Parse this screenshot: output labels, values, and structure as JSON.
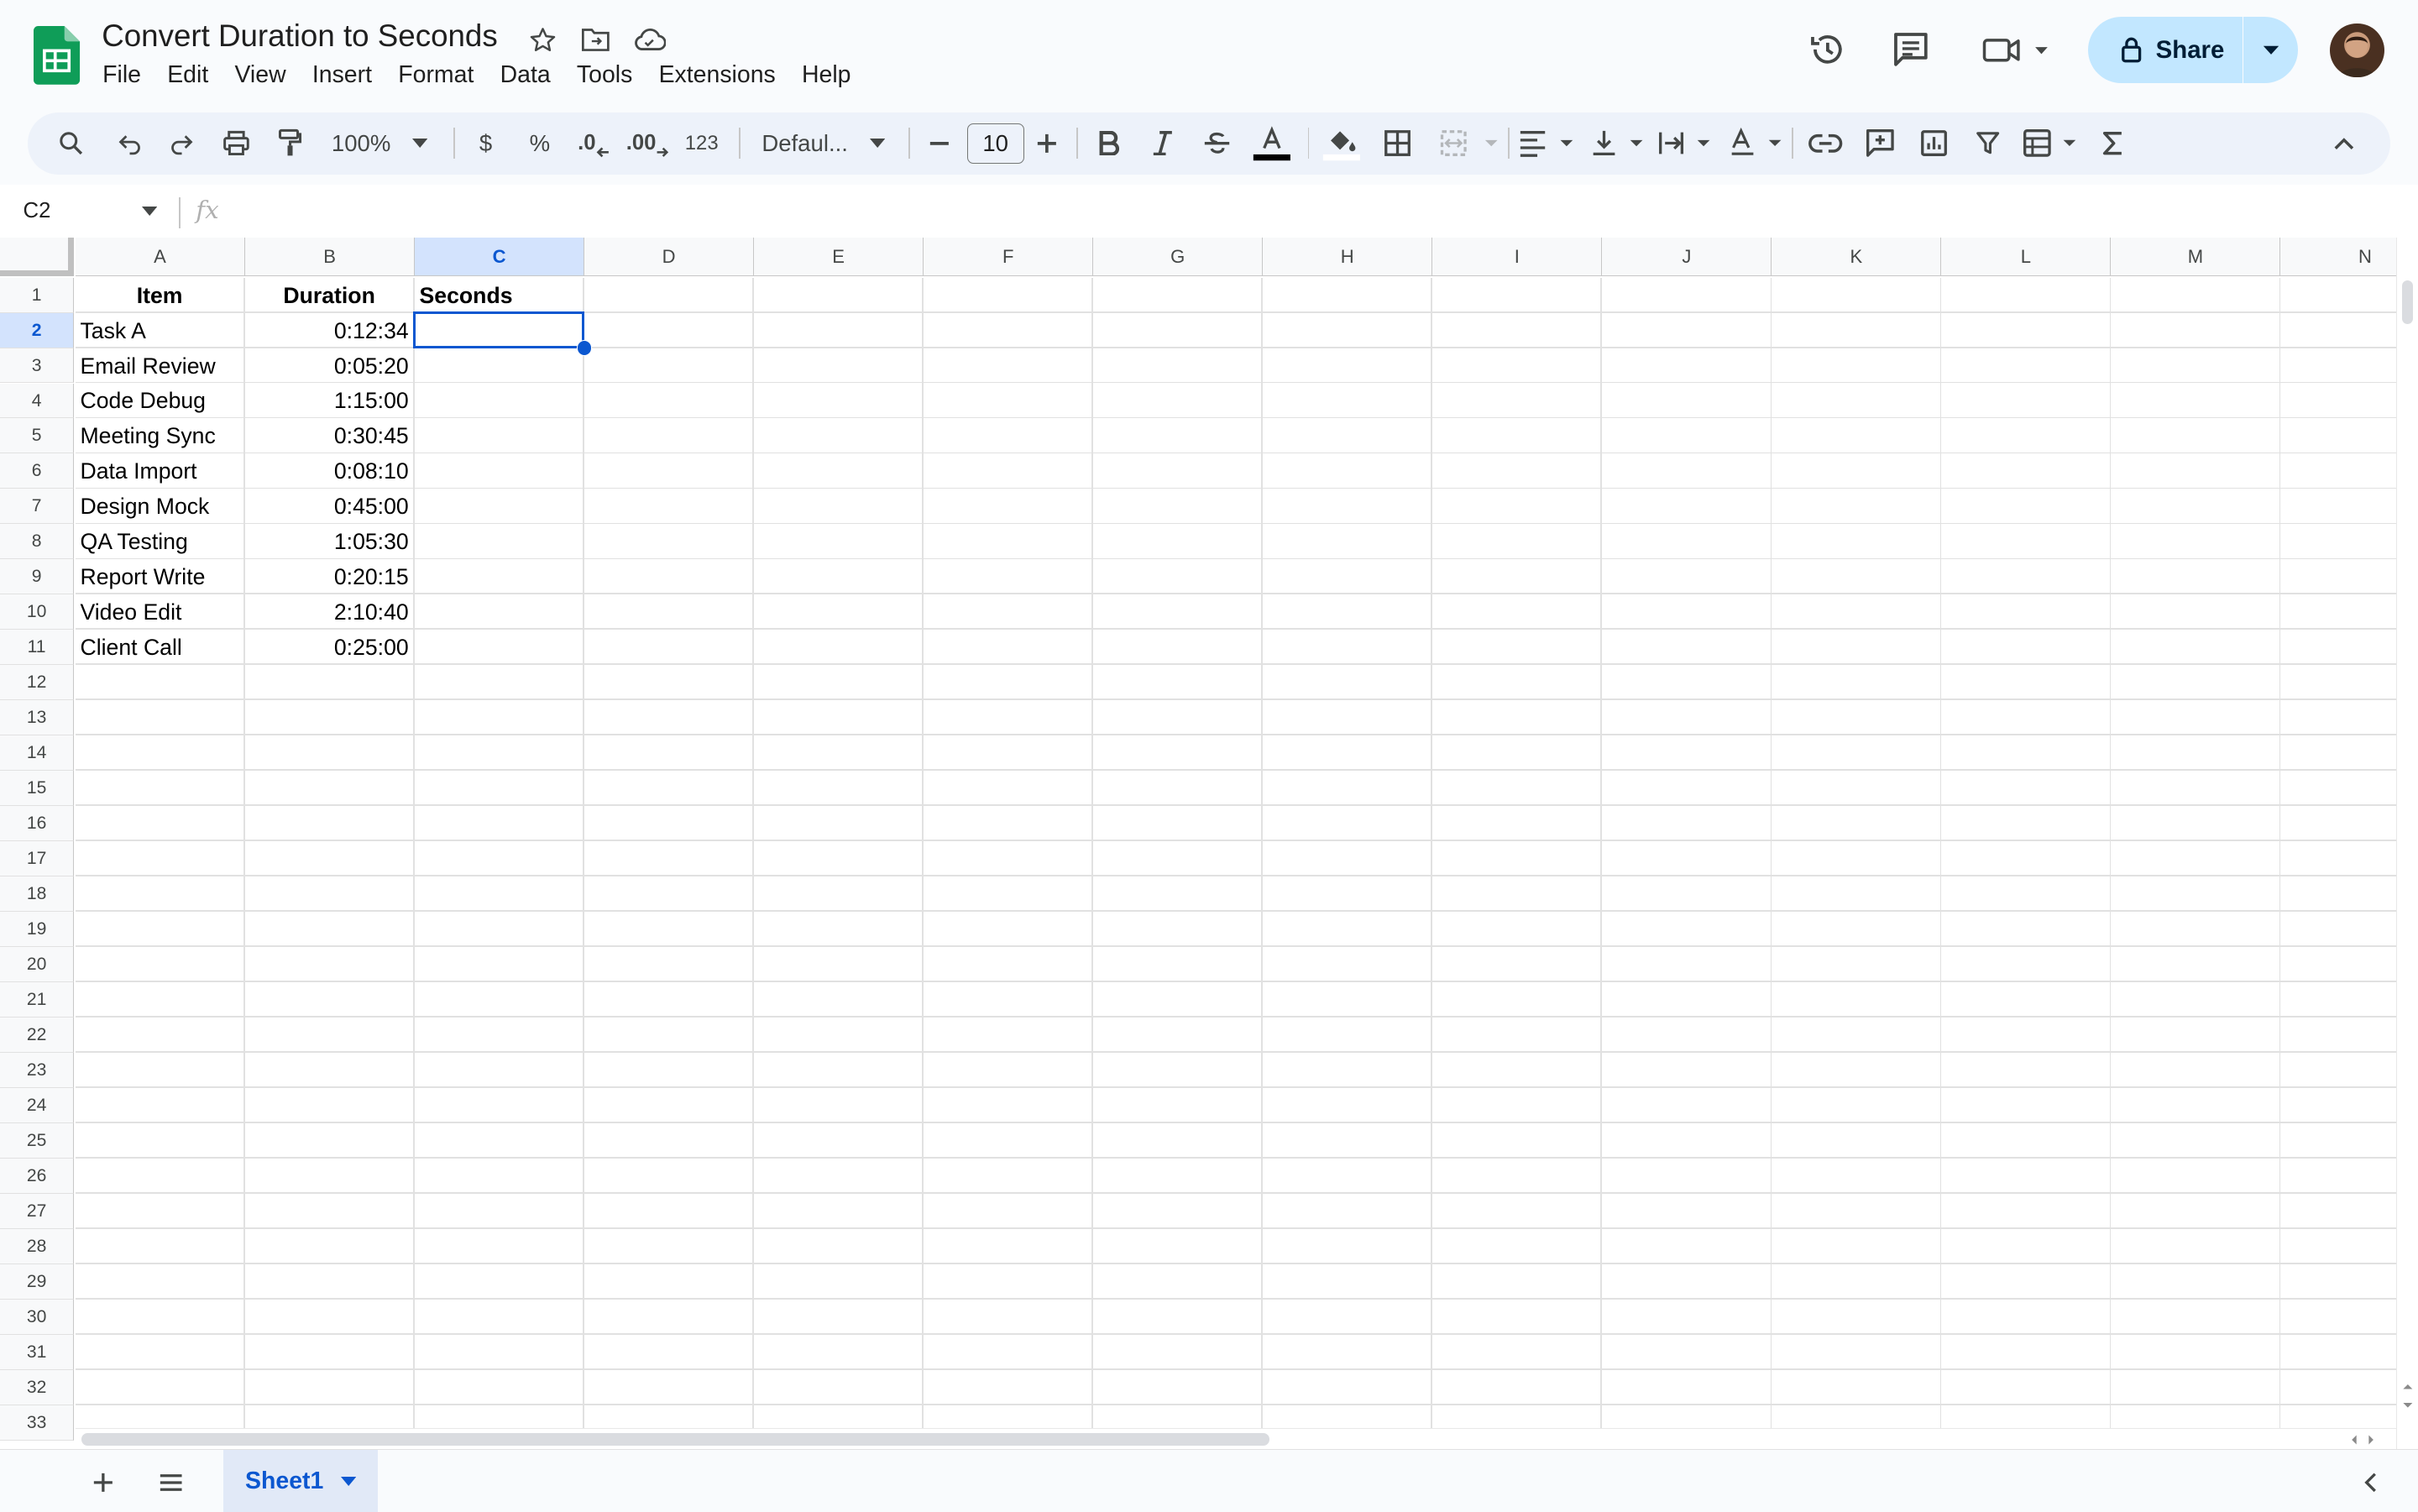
{
  "app": {
    "doc_title": "Convert Duration to Seconds",
    "menus": [
      "File",
      "Edit",
      "View",
      "Insert",
      "Format",
      "Data",
      "Tools",
      "Extensions",
      "Help"
    ],
    "share_label": "Share"
  },
  "toolbar": {
    "zoom": "100%",
    "currency": "$",
    "percent": "%",
    "decrease_decimal": ".0",
    "increase_decimal": ".00",
    "number_format": "123",
    "font": "Defaul...",
    "font_size": "10"
  },
  "formula_bar": {
    "name_box": "C2",
    "fx": "fx",
    "content": ""
  },
  "grid": {
    "columns": [
      "A",
      "B",
      "C",
      "D",
      "E",
      "F",
      "G",
      "H",
      "I",
      "J",
      "K",
      "L",
      "M",
      "N"
    ],
    "rows": [
      "1",
      "2",
      "3",
      "4",
      "5",
      "6",
      "7",
      "8",
      "9",
      "10",
      "11",
      "12",
      "13",
      "14",
      "15",
      "16",
      "17",
      "18",
      "19",
      "20",
      "21",
      "22",
      "23",
      "24",
      "25",
      "26",
      "27",
      "28",
      "29",
      "30",
      "31",
      "32",
      "33"
    ],
    "selected_cell": "C2",
    "headers": [
      "Item",
      "Duration",
      "Seconds"
    ],
    "data": [
      [
        "Task A",
        "0:12:34",
        ""
      ],
      [
        "Email Review",
        "0:05:20",
        ""
      ],
      [
        "Code Debug",
        "1:15:00",
        ""
      ],
      [
        "Meeting Sync",
        "0:30:45",
        ""
      ],
      [
        "Data Import",
        "0:08:10",
        ""
      ],
      [
        "Design Mock",
        "0:45:00",
        ""
      ],
      [
        "QA Testing",
        "1:05:30",
        ""
      ],
      [
        "Report Write",
        "0:20:15",
        ""
      ],
      [
        "Video Edit",
        "2:10:40",
        ""
      ],
      [
        "Client Call",
        "0:25:00",
        ""
      ]
    ]
  },
  "sheets": {
    "active": "Sheet1"
  }
}
